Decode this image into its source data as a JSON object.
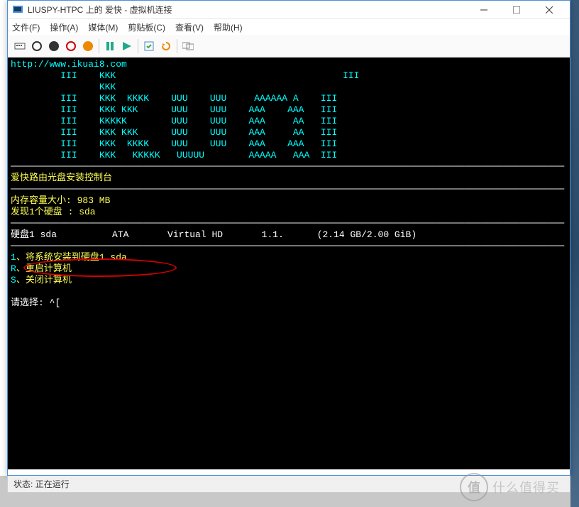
{
  "window": {
    "title": "LIUSPY-HTPC 上的 爱快 - 虚拟机连接",
    "menu": {
      "file": "文件(F)",
      "action": "操作(A)",
      "media": "媒体(M)",
      "clipboard": "剪贴板(C)",
      "view": "查看(V)",
      "help": "帮助(H)"
    }
  },
  "toolbar": {
    "icons": [
      "ctrl-alt-del",
      "power",
      "stop",
      "record",
      "reset",
      "sep",
      "pause",
      "play",
      "sep",
      "revert",
      "snapshot",
      "sep",
      "share"
    ]
  },
  "terminal": {
    "url": "http://www.ikuai8.com",
    "ascii": [
      "         III    KKK                                         III",
      "                KKK",
      "         III    KKK  KKKK    UUU    UUU     AAAAAA A    III",
      "         III    KKK KKK      UUU    UUU    AAA    AAA   III",
      "         III    KKKKK        UUU    UUU    AAA     AA   III",
      "         III    KKK KKK      UUU    UUU    AAA     AA   III",
      "         III    KKK  KKKK    UUU    UUU    AAA    AAA   III",
      "         III    KKK   KKKKK   UUUUU        AAAAA   AAA  III"
    ],
    "header": "爱快路由光盘安装控制台",
    "mem_line": "内存容量大小: 983 MB",
    "disk_found": "发现1个硬盘 : sda",
    "disk_row": {
      "name": "硬盘1 sda",
      "bus": "ATA",
      "model": "Virtual HD",
      "ver": "1.1.",
      "size": "(2.14 GB/2.00 GiB)"
    },
    "opts": {
      "k1": "1",
      "l1": "、将系统安装到硬盘1 sda",
      "k2": "R",
      "l2": "、重启计算机",
      "k3": "S",
      "l3": "、关闭计算机"
    },
    "prompt": "请选择: ^["
  },
  "status": {
    "label": "状态:",
    "value": "正在运行"
  },
  "watermark": {
    "circle": "值",
    "text": "什么值得买"
  }
}
